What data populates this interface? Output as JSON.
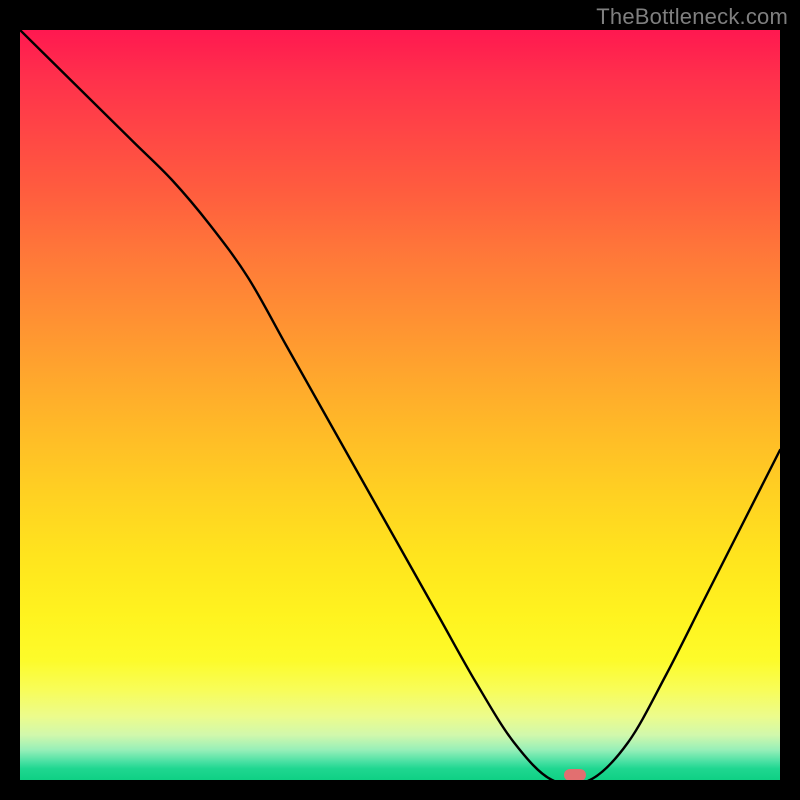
{
  "watermark": "TheBottleneck.com",
  "chart_data": {
    "type": "line",
    "title": "",
    "xlabel": "",
    "ylabel": "",
    "xlim": [
      0,
      100
    ],
    "ylim": [
      0,
      100
    ],
    "grid": false,
    "legend": false,
    "x": [
      0,
      5,
      10,
      15,
      20,
      25,
      30,
      35,
      40,
      45,
      50,
      55,
      60,
      65,
      70,
      75,
      80,
      85,
      90,
      95,
      100
    ],
    "values": [
      100,
      95,
      90,
      85,
      80,
      74,
      67,
      58,
      49,
      40,
      31,
      22,
      13,
      5,
      0,
      0,
      5,
      14,
      24,
      34,
      44
    ],
    "marker": {
      "x": 73,
      "y": 0
    },
    "gradient_colors": {
      "top": "#ff1850",
      "mid": "#ffd122",
      "bottom": "#0fd084"
    }
  }
}
